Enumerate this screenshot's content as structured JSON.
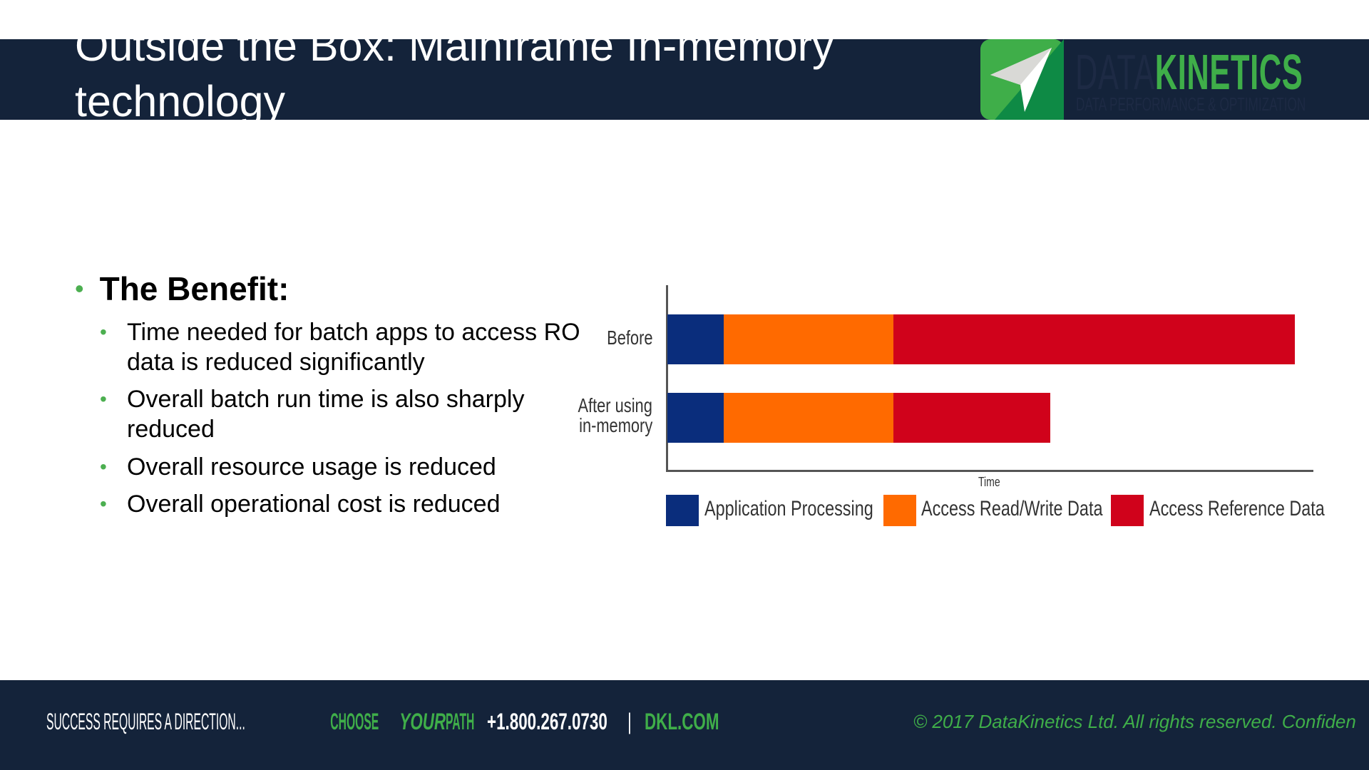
{
  "header": {
    "title": "Outside the Box: Mainframe In-memory technology"
  },
  "logo": {
    "name_part1": "DATA",
    "name_part2": "KINETICS",
    "tagline": "DATA PERFORMANCE & OPTIMIZATION"
  },
  "content": {
    "heading": "The Benefit:",
    "bullets": [
      "Time needed for batch apps to access RO data is reduced significantly",
      "Overall batch run time is also sharply reduced",
      "Overall resource usage is reduced",
      "Overall operational cost is reduced"
    ]
  },
  "chart_data": {
    "type": "bar",
    "orientation": "horizontal",
    "stacked": true,
    "categories": [
      "Before",
      "After using in-memory"
    ],
    "category_lines": [
      [
        "Before"
      ],
      [
        "After using",
        "in-memory"
      ]
    ],
    "series": [
      {
        "name": "Application Processing",
        "color": "#0a2d7c",
        "values": [
          9,
          9
        ]
      },
      {
        "name": "Access Read/Write Data",
        "color": "#ff6a00",
        "values": [
          27,
          27
        ]
      },
      {
        "name": "Access Reference Data",
        "color": "#d0021b",
        "values": [
          64,
          25
        ]
      }
    ],
    "xlabel": "Time",
    "xlim": [
      0,
      103
    ],
    "grid": false,
    "legend": "bottom"
  },
  "footer": {
    "slogan": "SUCCESS REQUIRES A DIRECTION...",
    "slogan_accent1": "CHOOSE ",
    "slogan_accent2": "YOUR",
    "slogan_accent3": " PATH",
    "phone": "+1.800.267.0730",
    "separator": "|",
    "website": "DKL.COM",
    "copyright": "© 2017 DataKinetics Ltd.   All rights reserved. Confiden"
  },
  "colors": {
    "navy": "#14233a",
    "green": "#3fae49"
  }
}
